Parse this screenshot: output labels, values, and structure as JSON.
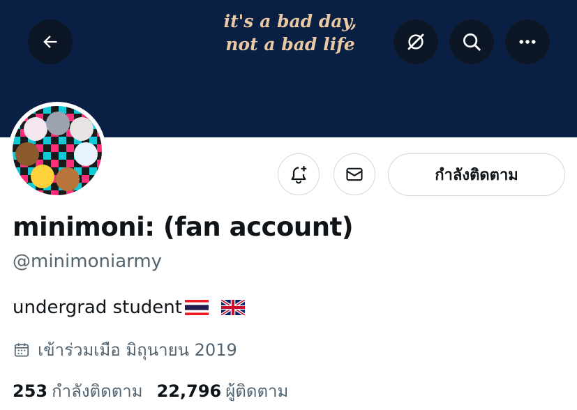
{
  "banner": {
    "quote_line1": "it's a bad day,",
    "quote_line2": "not a bad life"
  },
  "header": {
    "back_icon": "arrow-left-icon",
    "grok_icon": "grok-icon",
    "search_icon": "search-icon",
    "more_icon": "more-icon"
  },
  "actions": {
    "notify_icon": "bell-plus-icon",
    "message_icon": "envelope-icon",
    "follow_label": "กำลังติดตาม"
  },
  "profile": {
    "display_name": "minimoni: (fan account)",
    "handle": "@minimoniarmy",
    "bio": "undergrad student",
    "bio_flags": [
      "thailand-flag",
      "uk-flag"
    ],
    "joined": "เข้าร่วมเมือ มิถุนายน 2019",
    "following_count": "253",
    "following_label": "กำลังติดตาม",
    "followers_count": "22,796",
    "followers_label": "ผู้ติดตาม"
  },
  "colors": {
    "banner": "#0a1f44",
    "accent_text": "#0f1419",
    "muted": "#536471",
    "quote": "#e9c9a3"
  }
}
